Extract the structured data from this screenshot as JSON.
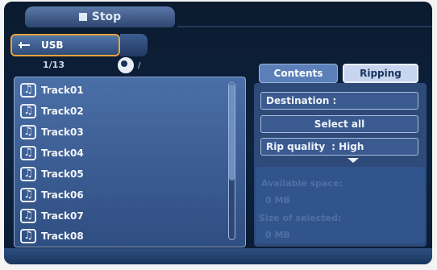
{
  "top_bar": {
    "status_label": "Stop"
  },
  "source": {
    "label": "USB"
  },
  "track_list": {
    "count_label": "1/13",
    "path_label": "/",
    "tracks": [
      "Track01",
      "Track02",
      "Track03",
      "Track04",
      "Track05",
      "Track06",
      "Track07",
      "Track08"
    ]
  },
  "tabs": {
    "contents": "Contents",
    "ripping": "Ripping"
  },
  "ripping": {
    "destination_label": "Destination :",
    "select_all_label": "Select all",
    "rip_quality_label": "Rip quality",
    "rip_quality_value": ": High",
    "available_space_label": "Available space:",
    "available_space_value": "0 MB",
    "size_selected_label": "Size of selected:",
    "size_selected_value": "0 MB"
  },
  "icons": {
    "stop": "stop-square-icon",
    "usb": "usb-icon",
    "disc": "disc-icon",
    "track": "music-note-icon",
    "expand": "chevron-down-icon"
  }
}
